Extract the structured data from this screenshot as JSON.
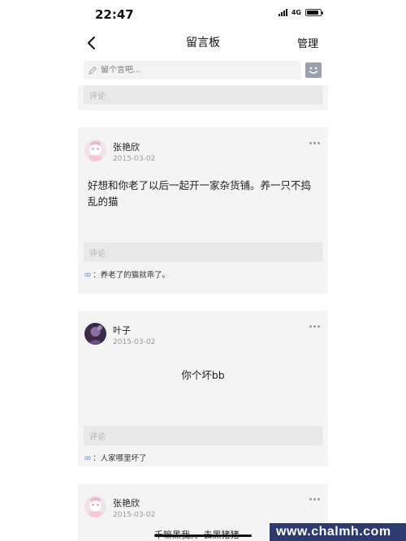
{
  "status_bar": {
    "time": "22:47",
    "network": "4G",
    "battery_level": 0.85
  },
  "nav": {
    "title": "留言板",
    "manage_label": "管理",
    "back_icon": "chevron-left-icon"
  },
  "comment_box": {
    "placeholder": "留个言吧...",
    "icon": "pencil-icon",
    "emoji_icon": "emoji-icon"
  },
  "reply_placeholder": "评论",
  "posts": [
    {
      "author": "张艳欣",
      "date": "2015-03-02",
      "content": "好想和你老了以后一起开一家杂货铺。养一只不捣乱的猫",
      "reply": "：养老了的猫就乖了。"
    },
    {
      "author": "叶子",
      "date": "2015-03-02",
      "content": "你个坏bb",
      "reply": "：人家哪里坏了"
    },
    {
      "author": "张艳欣",
      "date": "2015-03-02",
      "content": "千嘛黑我。。去黑猪猪"
    }
  ],
  "watermark": "www.chalmh.com"
}
